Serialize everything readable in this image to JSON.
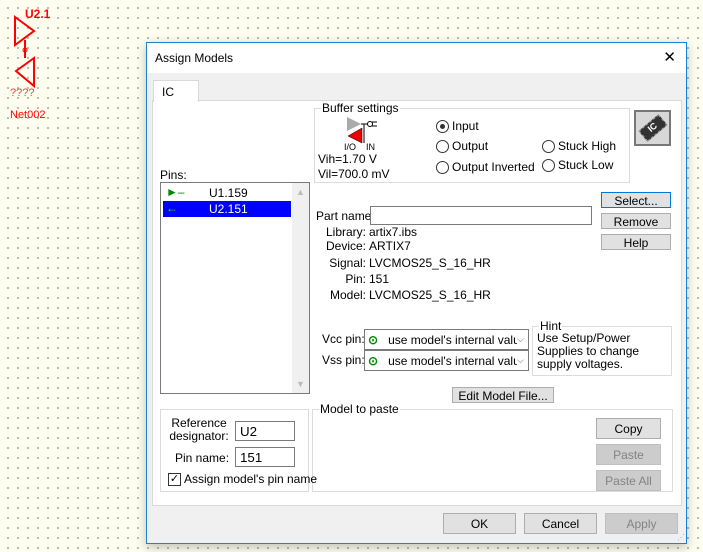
{
  "schematic": {
    "part_label": "U2.1",
    "pin_label": "????",
    "net_label": "Net002"
  },
  "dialog": {
    "title": "Assign Models",
    "close": "✕",
    "tab": "IC",
    "buffer": {
      "title": "Buffer settings",
      "io_label": "I/O",
      "in_label": "IN",
      "vih": "Vih=1.70 V",
      "vil": "Vil=700.0 mV",
      "options": [
        "Input",
        "Output",
        "Output Inverted",
        "Stuck High",
        "Stuck Low"
      ],
      "selected": "Input"
    },
    "pins": {
      "label": "Pins:",
      "items": [
        "U1.159",
        "U2.151"
      ],
      "selected": "U2.151"
    },
    "part_name_label": "Part name:",
    "part_name_value": "",
    "buttons": {
      "select": "Select...",
      "remove": "Remove",
      "help": "Help",
      "edit_model": "Edit Model File...",
      "copy": "Copy",
      "paste": "Paste",
      "paste_all": "Paste All",
      "ok": "OK",
      "cancel": "Cancel",
      "apply": "Apply"
    },
    "info": [
      {
        "label": "Library:",
        "value": "artix7.ibs"
      },
      {
        "label": "Device:",
        "value": "ARTIX7"
      },
      {
        "label": "Signal:",
        "value": "LVCMOS25_S_16_HR"
      },
      {
        "label": "Pin:",
        "value": "151"
      },
      {
        "label": "Model:",
        "value": "LVCMOS25_S_16_HR"
      }
    ],
    "vcc_label": "Vcc pin:",
    "vcc_value": "use model's internal valu",
    "vss_label": "Vss pin:",
    "vss_value": "use model's internal valu",
    "hint": {
      "title": "Hint",
      "text": "Use Setup/Power Supplies to change supply voltages."
    },
    "model_to_paste": "Model to paste",
    "ref": {
      "label": "Reference designator:",
      "value": "U2",
      "pin_label": "Pin name:",
      "pin_value": "151",
      "checkbox": "Assign model's pin name",
      "checked": true
    }
  }
}
